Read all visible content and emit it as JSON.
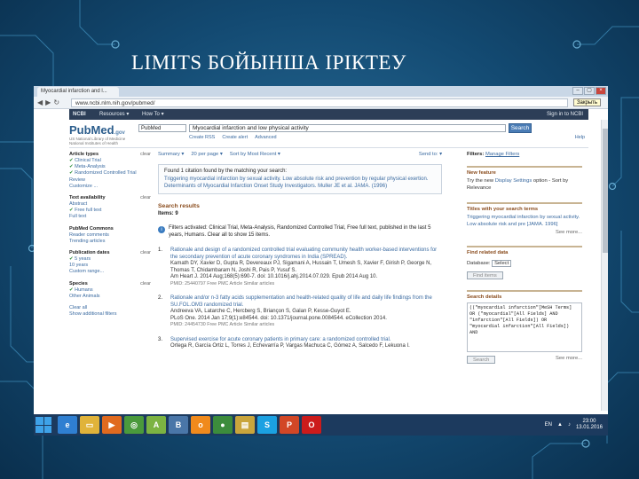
{
  "slide": {
    "title": "LIMITS БОЙЫНША ІРІКТЕУ"
  },
  "browser": {
    "tab_label": "Myocardial infarction and l...",
    "url": "www.ncbi.nlm.nih.gov/pubmed/",
    "tooltip": "Закрыть"
  },
  "ncbi": {
    "logo": "NCBI",
    "resources": "Resources ▾",
    "howto": "How To ▾",
    "signin": "Sign in to NCBI"
  },
  "search": {
    "logo_text": "PubMed",
    "logo_gov": ".gov",
    "logo_sub": "US National Library of Medicine National Institutes of Health",
    "database": "PubMed",
    "query": "Myocardial infarction and low physical activity",
    "button": "Search",
    "links": [
      "Create RSS",
      "Create alert",
      "Advanced"
    ],
    "help": "Help"
  },
  "filters": [
    {
      "title": "Article types",
      "clear": "clear",
      "items": [
        {
          "label": "Clinical Trial",
          "checked": true
        },
        {
          "label": "Meta-Analysis",
          "checked": true
        },
        {
          "label": "Randomized Controlled Trial",
          "checked": true
        },
        {
          "label": "Review",
          "checked": false
        },
        {
          "label": "Customize ...",
          "checked": false
        }
      ]
    },
    {
      "title": "Text availability",
      "clear": "clear",
      "items": [
        {
          "label": "Abstract",
          "checked": false
        },
        {
          "label": "Free full text",
          "checked": true
        },
        {
          "label": "Full text",
          "checked": false
        }
      ]
    },
    {
      "title": "PubMed Commons",
      "clear": "",
      "items": [
        {
          "label": "Reader comments",
          "checked": false
        },
        {
          "label": "Trending articles",
          "checked": false
        }
      ]
    },
    {
      "title": "Publication dates",
      "clear": "clear",
      "items": [
        {
          "label": "5 years",
          "checked": true
        },
        {
          "label": "10 years",
          "checked": false
        },
        {
          "label": "Custom range...",
          "checked": false
        }
      ]
    },
    {
      "title": "Species",
      "clear": "clear",
      "items": [
        {
          "label": "Humans",
          "checked": true
        },
        {
          "label": "Other Animals",
          "checked": false
        }
      ]
    },
    {
      "title": "",
      "clear": "",
      "items": [
        {
          "label": "Clear all",
          "checked": false
        },
        {
          "label": "Show additional filters",
          "checked": false
        }
      ]
    }
  ],
  "toolbar": {
    "summary": "Summary ▾",
    "per_page": "20 per page ▾",
    "sort": "Sort by Most Recent ▾",
    "send_to": "Send to: ▾"
  },
  "citation": {
    "found": "Found 1 citation found by the matching your search:",
    "text": "Triggering myocardial infarction by sexual activity. Low absolute risk and prevention by regular physical exertion. Determinants of Myocardial Infarction Onset Study Investigators. Muller JE et al. JAMA. (1996)"
  },
  "results": {
    "title": "Search results",
    "items_label": "Items: 9",
    "filters_active": "Filters activated: Clinical Trial, Meta-Analysis, Randomized Controlled Trial, Free full text, published in the last 5 years, Humans. Clear all to show 15 items.",
    "list": [
      {
        "num": "1.",
        "title": "Rationale and design of a randomized controlled trial evaluating community health worker-based interventions for the secondary prevention of acute coronary syndromes in India (SPREAD).",
        "authors": "Kamath DY, Xavier D, Gupta R, Devereaux PJ, Sigamani A, Hussain T, Umesh S, Xavier F, Girish P, George N, Thomas T, Chidambaram N, Joshi R, Pais P, Yusuf S.",
        "source": "Am Heart J. 2014 Aug;168(5):690-7. doi: 10.1016/j.ahj.2014.07.029. Epub 2014 Aug 10.",
        "links": "PMID: 25440797  Free PMC Article  Similar articles"
      },
      {
        "num": "2.",
        "title": "Rationale and/or n-3 fatty acids supplementation and health-related quality of life and daily life findings from the SU.FOL.OM3 randomized trial.",
        "authors": "Andreeva VA, Latarche C, Hercberg S, Briançon S, Galan P, Kesse-Guyot E.",
        "source": "PLoS One. 2014 Jan 17;9(1):e84544. doi: 10.1371/journal.pone.0084544. eCollection 2014.",
        "links": "PMID: 24454730  Free PMC Article  Similar articles"
      },
      {
        "num": "3.",
        "title": "Supervised exercise for acute coronary patients in primary care: a randomized controlled trial.",
        "authors": "Ortega R, García Ortiz L, Torres J, Echevarría P, Vargas Machuca C, Gómez A, Salcedo F, Lekuona I.",
        "source": "",
        "links": ""
      }
    ]
  },
  "sidebar": {
    "filters_label": "Filters: ",
    "manage_filters": "Manage Filters",
    "new_feature": {
      "title": "New feature",
      "text": "Try the new ",
      "link": "Display Settings",
      "text2": " option - Sort by Relevance"
    },
    "titles_terms": {
      "title": "Titles with your search terms",
      "link": "Triggering myocardial infarction by sexual activity. Low absolute risk and pre [JAMA. 1996]",
      "more": "See more..."
    },
    "find_related": {
      "title": "Find related data",
      "database_label": "Database:",
      "select": "Select",
      "button": "Find items"
    },
    "search_details": {
      "title": "Search details",
      "text": "((\"myocardial infarction\"[MeSH Terms] OR (\"myocardial\"[All Fields] AND \"infarction\"[All Fields]) OR \"myocardial infarction\"[All Fields]) AND",
      "button": "Search",
      "more": "See more..."
    }
  },
  "taskbar": {
    "apps": [
      {
        "name": "internet-explorer-icon",
        "glyph": "e",
        "color": "#2f7fd1"
      },
      {
        "name": "file-explorer-icon",
        "glyph": "▭",
        "color": "#e0b33a"
      },
      {
        "name": "media-player-icon",
        "glyph": "▶",
        "color": "#e06a1f"
      },
      {
        "name": "search-app-icon",
        "glyph": "◎",
        "color": "#4a9a3c"
      },
      {
        "name": "android-icon",
        "glyph": "A",
        "color": "#7cb342"
      },
      {
        "name": "vk-icon",
        "glyph": "B",
        "color": "#4a76a8"
      },
      {
        "name": "odnoklassniki-icon",
        "glyph": "о",
        "color": "#f08a1c"
      },
      {
        "name": "chrome-icon",
        "glyph": "●",
        "color": "#3c8c3c"
      },
      {
        "name": "files-icon",
        "glyph": "▤",
        "color": "#c9a53c"
      },
      {
        "name": "skype-icon",
        "glyph": "S",
        "color": "#1ba1e2"
      },
      {
        "name": "powerpoint-icon",
        "glyph": "P",
        "color": "#d24726"
      },
      {
        "name": "opera-icon",
        "glyph": "O",
        "color": "#cc1b1b"
      }
    ],
    "lang": "EN",
    "time": "23:00",
    "date": "13.01.2016"
  }
}
